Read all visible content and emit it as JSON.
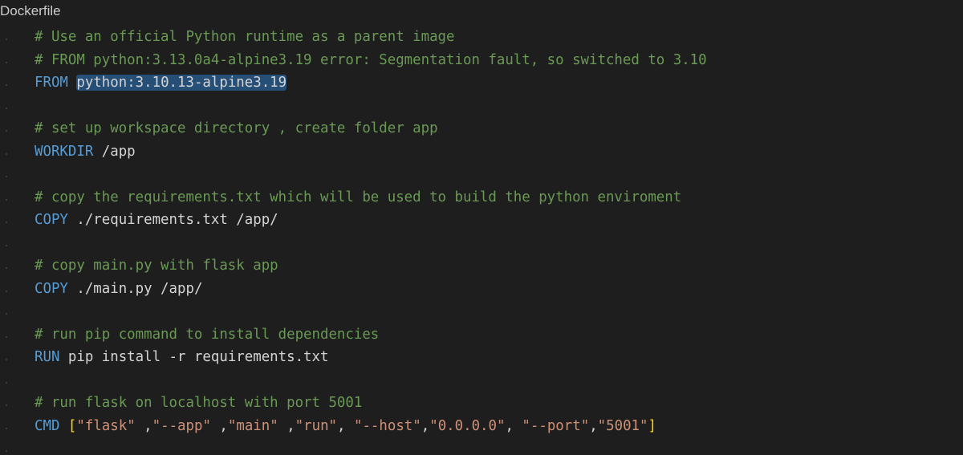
{
  "file": {
    "name": "Dockerfile"
  },
  "code": {
    "l1": {
      "comment": "# Use an official Python runtime as a parent image"
    },
    "l2": {
      "comment": "# FROM python:3.13.0a4-alpine3.19 error: Segmentation fault, so switched to 3.10"
    },
    "l3": {
      "keyword": "FROM",
      "selected": "python:3.10.13-alpine3.19"
    },
    "l5": {
      "comment": "# set up workspace directory , create folder app"
    },
    "l6": {
      "keyword": "WORKDIR",
      "args": " /app"
    },
    "l8": {
      "comment": "# copy the requirements.txt which will be used to build the python enviroment"
    },
    "l9": {
      "keyword": "COPY",
      "args": " ./requirements.txt /app/"
    },
    "l11": {
      "comment": "# copy main.py with flask app"
    },
    "l12": {
      "keyword": "COPY",
      "args": " ./main.py /app/"
    },
    "l14": {
      "comment": "# run pip command to install dependencies"
    },
    "l15": {
      "keyword": "RUN",
      "args": " pip install -r requirements.txt"
    },
    "l17": {
      "comment": "# run flask on localhost with port 5001"
    },
    "l18": {
      "keyword": "CMD",
      "open": "[",
      "s1": "\"flask\"",
      "c1": " ,",
      "s2": "\"--app\"",
      "c2": " ,",
      "s3": "\"main\"",
      "c3": " ,",
      "s4": "\"run\"",
      "c4": ", ",
      "s5": "\"--host\"",
      "c5": ",",
      "s6": "\"0.0.0.0\"",
      "c6": ", ",
      "s7": "\"--port\"",
      "c7": ",",
      "s8": "\"5001\"",
      "close": "]"
    }
  },
  "colors": {
    "background": "#1e1e1e",
    "comment": "#6a9955",
    "keyword": "#569cd6",
    "text": "#d4d4d4",
    "string": "#ce9178",
    "bracket": "#ffd700",
    "selection": "#264f78"
  }
}
